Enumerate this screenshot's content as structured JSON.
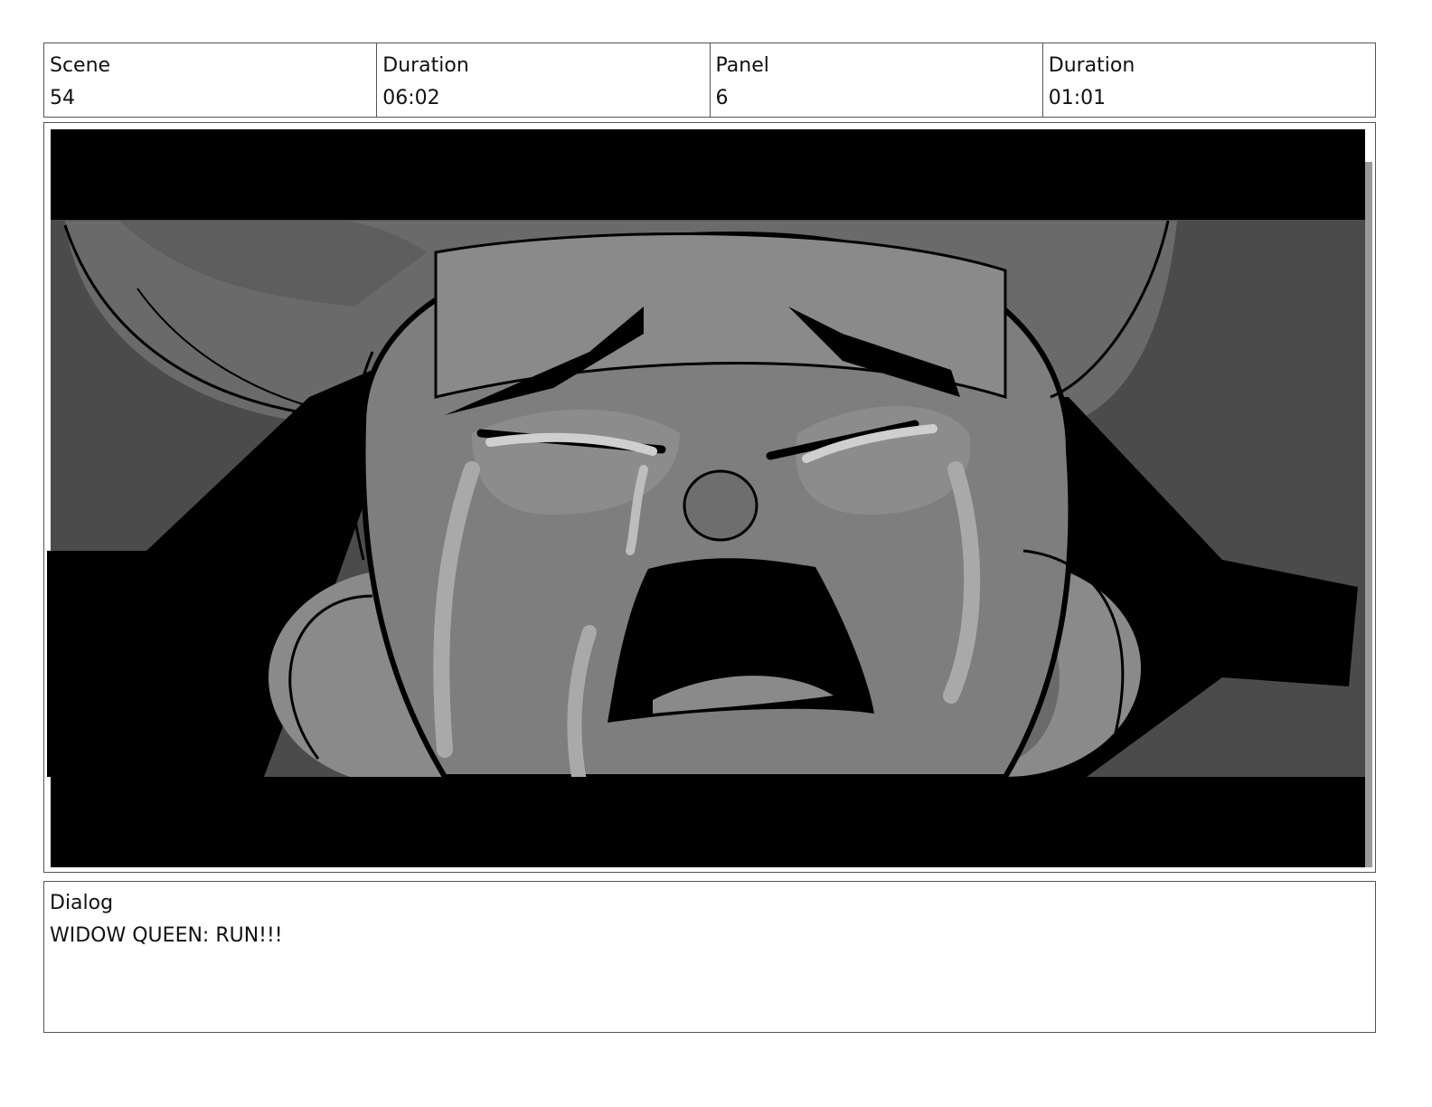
{
  "header": {
    "scene_label": "Scene",
    "scene_value": "54",
    "scene_duration_label": "Duration",
    "scene_duration_value": "06:02",
    "panel_label": "Panel",
    "panel_value": "6",
    "panel_duration_label": "Duration",
    "panel_duration_value": "01:01"
  },
  "frame": {
    "description_icon": "storyboard-sketch-crying-face"
  },
  "dialog": {
    "label": "Dialog",
    "text": "WIDOW QUEEN: RUN!!!"
  }
}
